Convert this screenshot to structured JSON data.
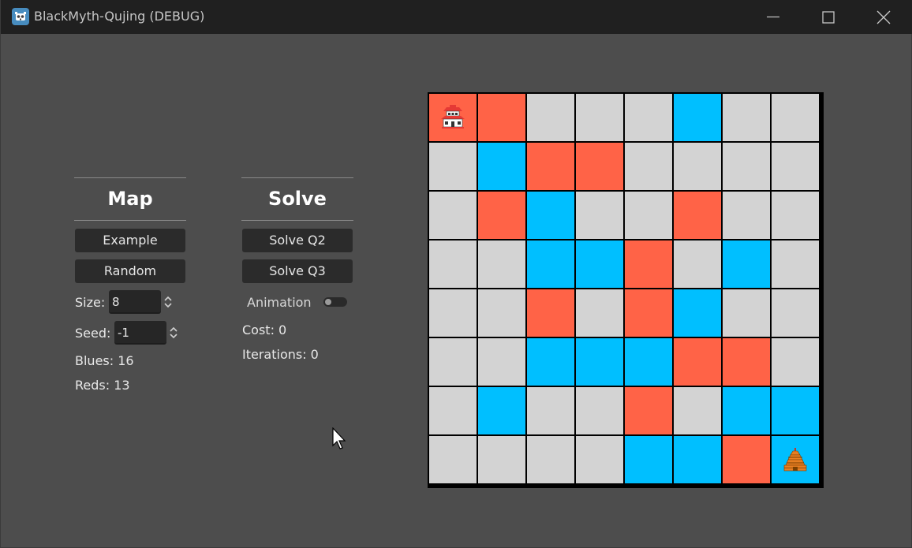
{
  "window": {
    "title": "BlackMyth-Qujing (DEBUG)"
  },
  "map_panel": {
    "heading": "Map",
    "example_button": "Example",
    "random_button": "Random",
    "size_label": "Size:",
    "size_value": "8",
    "seed_label": "Seed:",
    "seed_value": "-1",
    "blues_text": "Blues: 16",
    "reds_text": "Reds: 13"
  },
  "solve_panel": {
    "heading": "Solve",
    "solve_q2_button": "Solve Q2",
    "solve_q3_button": "Solve Q3",
    "animation_label": "Animation",
    "animation_enabled": false,
    "cost_text": "Cost: 0",
    "iterations_text": "Iterations: 0"
  },
  "grid": {
    "rows": 8,
    "cols": 8,
    "colors": {
      "G": "#d3d3d3",
      "R": "#ff6347",
      "B": "#00bfff"
    },
    "cells": [
      [
        "R",
        "R",
        "G",
        "G",
        "G",
        "B",
        "G",
        "G"
      ],
      [
        "G",
        "B",
        "R",
        "R",
        "G",
        "G",
        "G",
        "G"
      ],
      [
        "G",
        "R",
        "B",
        "G",
        "G",
        "R",
        "G",
        "G"
      ],
      [
        "G",
        "G",
        "B",
        "B",
        "R",
        "G",
        "B",
        "G"
      ],
      [
        "G",
        "G",
        "R",
        "G",
        "R",
        "B",
        "G",
        "G"
      ],
      [
        "G",
        "G",
        "B",
        "B",
        "B",
        "R",
        "R",
        "G"
      ],
      [
        "G",
        "B",
        "G",
        "G",
        "R",
        "G",
        "B",
        "B"
      ],
      [
        "G",
        "G",
        "G",
        "G",
        "B",
        "B",
        "R",
        "B"
      ]
    ],
    "start": {
      "row": 0,
      "col": 0,
      "icon": "temple-icon"
    },
    "goal": {
      "row": 7,
      "col": 7,
      "icon": "pagoda-icon"
    }
  }
}
